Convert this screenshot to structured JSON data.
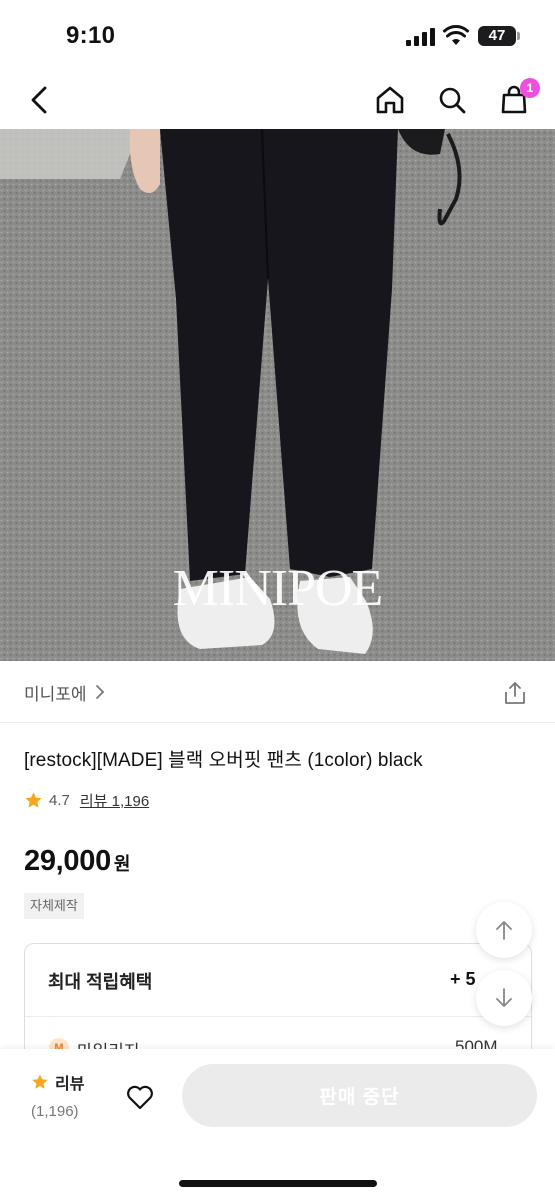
{
  "status_bar": {
    "time": "9:10",
    "battery": "47"
  },
  "nav": {
    "cart_count": "1"
  },
  "image": {
    "watermark": "MINIPOE"
  },
  "brand": {
    "name": "미니포에"
  },
  "product": {
    "title": "[restock][MADE] 블랙 오버핏 팬츠 (1color) black",
    "rating": "4.7",
    "review_link": "리뷰 1,196",
    "price": "29,000",
    "currency": "원",
    "tag": "자체제작"
  },
  "benefit": {
    "title": "최대 적립혜택",
    "amount": "+ 5",
    "item_icon": "M",
    "item_label": "마일리지",
    "item_value": "500M"
  },
  "bottom": {
    "review_label": "리뷰",
    "review_count": "(1,196)",
    "buy_label": "판매 중단"
  },
  "colors": {
    "accent_star": "#f5a623",
    "cart_badge": "#ef4fe0",
    "disabled_button": "#ebebeb"
  }
}
